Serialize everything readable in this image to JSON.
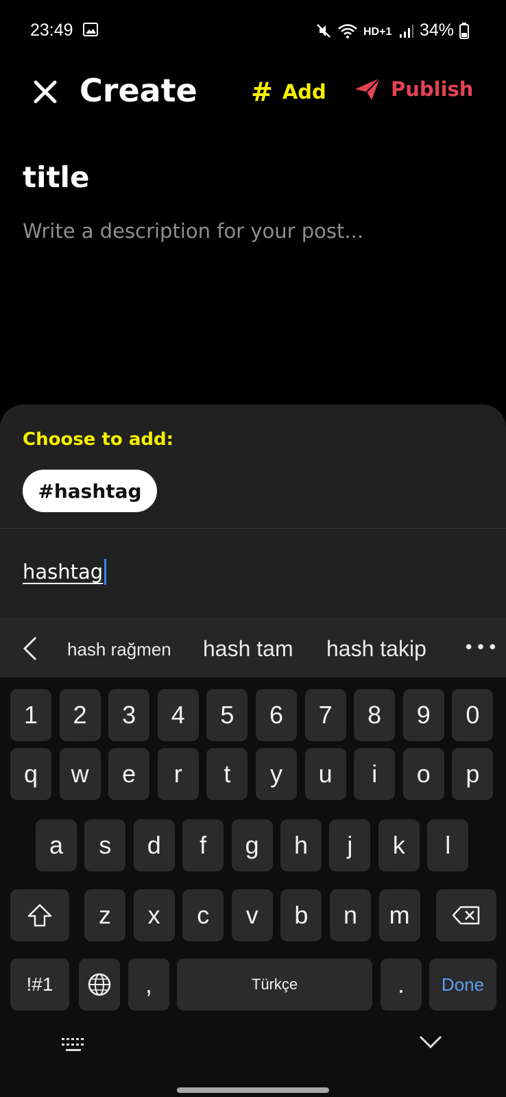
{
  "status_bar": {
    "time": "23:49",
    "battery": "34%",
    "icons": [
      "gallery-icon",
      "mute-icon",
      "wifi-icon",
      "hd-volte-icon",
      "signal-icon",
      "battery-icon"
    ]
  },
  "header": {
    "title": "Create",
    "add_label": "Add",
    "publish_label": "Publish",
    "add_color": "#f6f000",
    "publish_color": "#e24354"
  },
  "post": {
    "title": "title",
    "description_placeholder": "Write a description for your post..."
  },
  "sheet": {
    "label": "Choose to add:",
    "chip": "#hashtag",
    "input_value": "hashtag"
  },
  "keyboard": {
    "suggestions": [
      "hash rağmen",
      "hash tam",
      "hash takip"
    ],
    "more": "•••",
    "row_numbers": [
      "1",
      "2",
      "3",
      "4",
      "5",
      "6",
      "7",
      "8",
      "9",
      "0"
    ],
    "row_q": [
      "q",
      "w",
      "e",
      "r",
      "t",
      "y",
      "u",
      "i",
      "o",
      "p"
    ],
    "row_a": [
      "a",
      "s",
      "d",
      "f",
      "g",
      "h",
      "j",
      "k",
      "l"
    ],
    "row_z": [
      "z",
      "x",
      "c",
      "v",
      "b",
      "n",
      "m"
    ],
    "symbols_label": "!#1",
    "comma": ",",
    "space_label": "Türkçe",
    "period": ".",
    "done_label": "Done"
  }
}
